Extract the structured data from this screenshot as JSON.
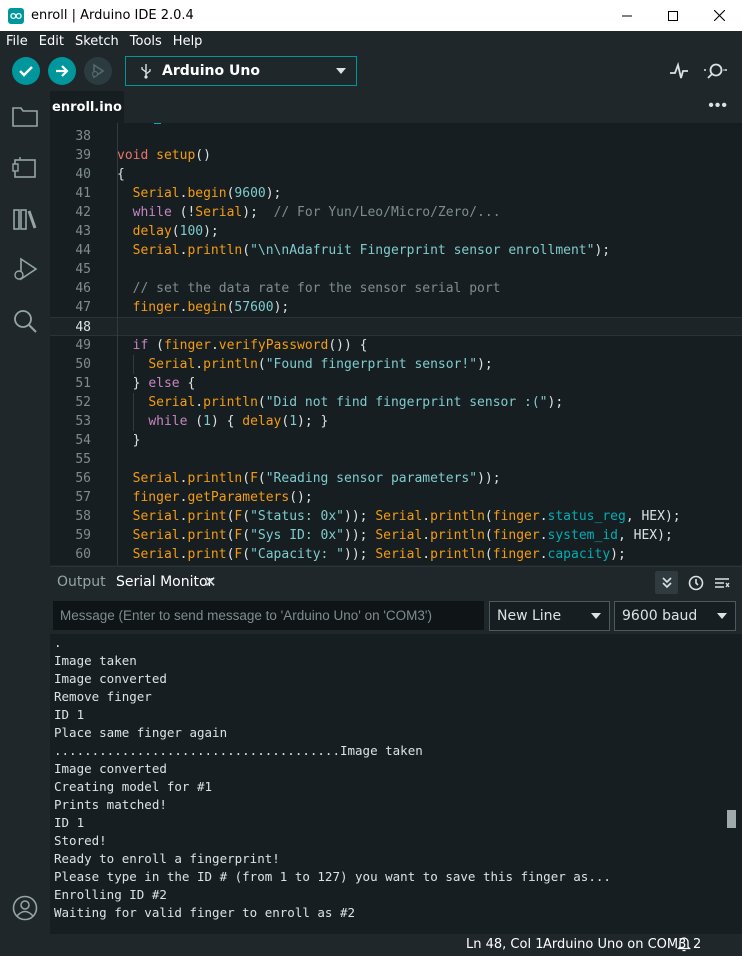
{
  "window": {
    "title": "enroll | Arduino IDE 2.0.4"
  },
  "menu": [
    "File",
    "Edit",
    "Sketch",
    "Tools",
    "Help"
  ],
  "toolbar": {
    "board": "Arduino Uno",
    "icons": [
      "verify-icon",
      "upload-icon",
      "debug-icon",
      "serial-plotter-icon",
      "serial-monitor-icon"
    ]
  },
  "activity_bar": [
    "sketchbook-icon",
    "boards-manager-icon",
    "library-manager-icon",
    "debug-icon",
    "search-icon",
    "account-icon"
  ],
  "editor": {
    "tab": "enroll.ino",
    "current_line": 48,
    "lines": [
      {
        "n": "38",
        "t": ""
      },
      {
        "n": "39",
        "t": "void setup()"
      },
      {
        "n": "40",
        "t": "{"
      },
      {
        "n": "41",
        "t": "  Serial.begin(9600);"
      },
      {
        "n": "42",
        "t": "  while (!Serial);  // For Yun/Leo/Micro/Zero/..."
      },
      {
        "n": "43",
        "t": "  delay(100);"
      },
      {
        "n": "44",
        "t": "  Serial.println(\"\\n\\nAdafruit Fingerprint sensor enrollment\");"
      },
      {
        "n": "45",
        "t": ""
      },
      {
        "n": "46",
        "t": "  // set the data rate for the sensor serial port"
      },
      {
        "n": "47",
        "t": "  finger.begin(57600);"
      },
      {
        "n": "48",
        "t": ""
      },
      {
        "n": "49",
        "t": "  if (finger.verifyPassword()) {"
      },
      {
        "n": "50",
        "t": "    Serial.println(\"Found fingerprint sensor!\");"
      },
      {
        "n": "51",
        "t": "  } else {"
      },
      {
        "n": "52",
        "t": "    Serial.println(\"Did not find fingerprint sensor :(\");"
      },
      {
        "n": "53",
        "t": "    while (1) { delay(1); }"
      },
      {
        "n": "54",
        "t": "  }"
      },
      {
        "n": "55",
        "t": ""
      },
      {
        "n": "56",
        "t": "  Serial.println(F(\"Reading sensor parameters\"));"
      },
      {
        "n": "57",
        "t": "  finger.getParameters();"
      },
      {
        "n": "58",
        "t": "  Serial.print(F(\"Status: 0x\")); Serial.println(finger.status_reg, HEX);"
      },
      {
        "n": "59",
        "t": "  Serial.print(F(\"Sys ID: 0x\")); Serial.println(finger.system_id, HEX);"
      },
      {
        "n": "60",
        "t": "  Serial.print(F(\"Capacity: \")); Serial.println(finger.capacity);"
      }
    ]
  },
  "panel": {
    "tab_output": "Output",
    "tab_serial": "Serial Monitor",
    "close_glyph": "✕",
    "message_placeholder": "Message (Enter to send message to 'Arduino Uno' on 'COM3')",
    "line_ending": "New Line",
    "baud": "9600 baud",
    "output_lines": [
      ".",
      "Image taken",
      "Image converted",
      "Remove finger",
      "ID 1",
      "Place same finger again",
      "......................................Image taken",
      "Image converted",
      "Creating model for #1",
      "Prints matched!",
      "ID 1",
      "Stored!",
      "Ready to enroll a fingerprint!",
      "Please type in the ID # (from 1 to 127) you want to save this finger as...",
      "Enrolling ID #2",
      "Waiting for valid finger to enroll as #2"
    ]
  },
  "status": {
    "position": "Ln 48, Col 1",
    "board_port": "Arduino Uno on COM3",
    "notifications": "2"
  },
  "colors": {
    "accent": "#00979c",
    "background": "#1f272b",
    "editor_bg": "#171e21"
  }
}
